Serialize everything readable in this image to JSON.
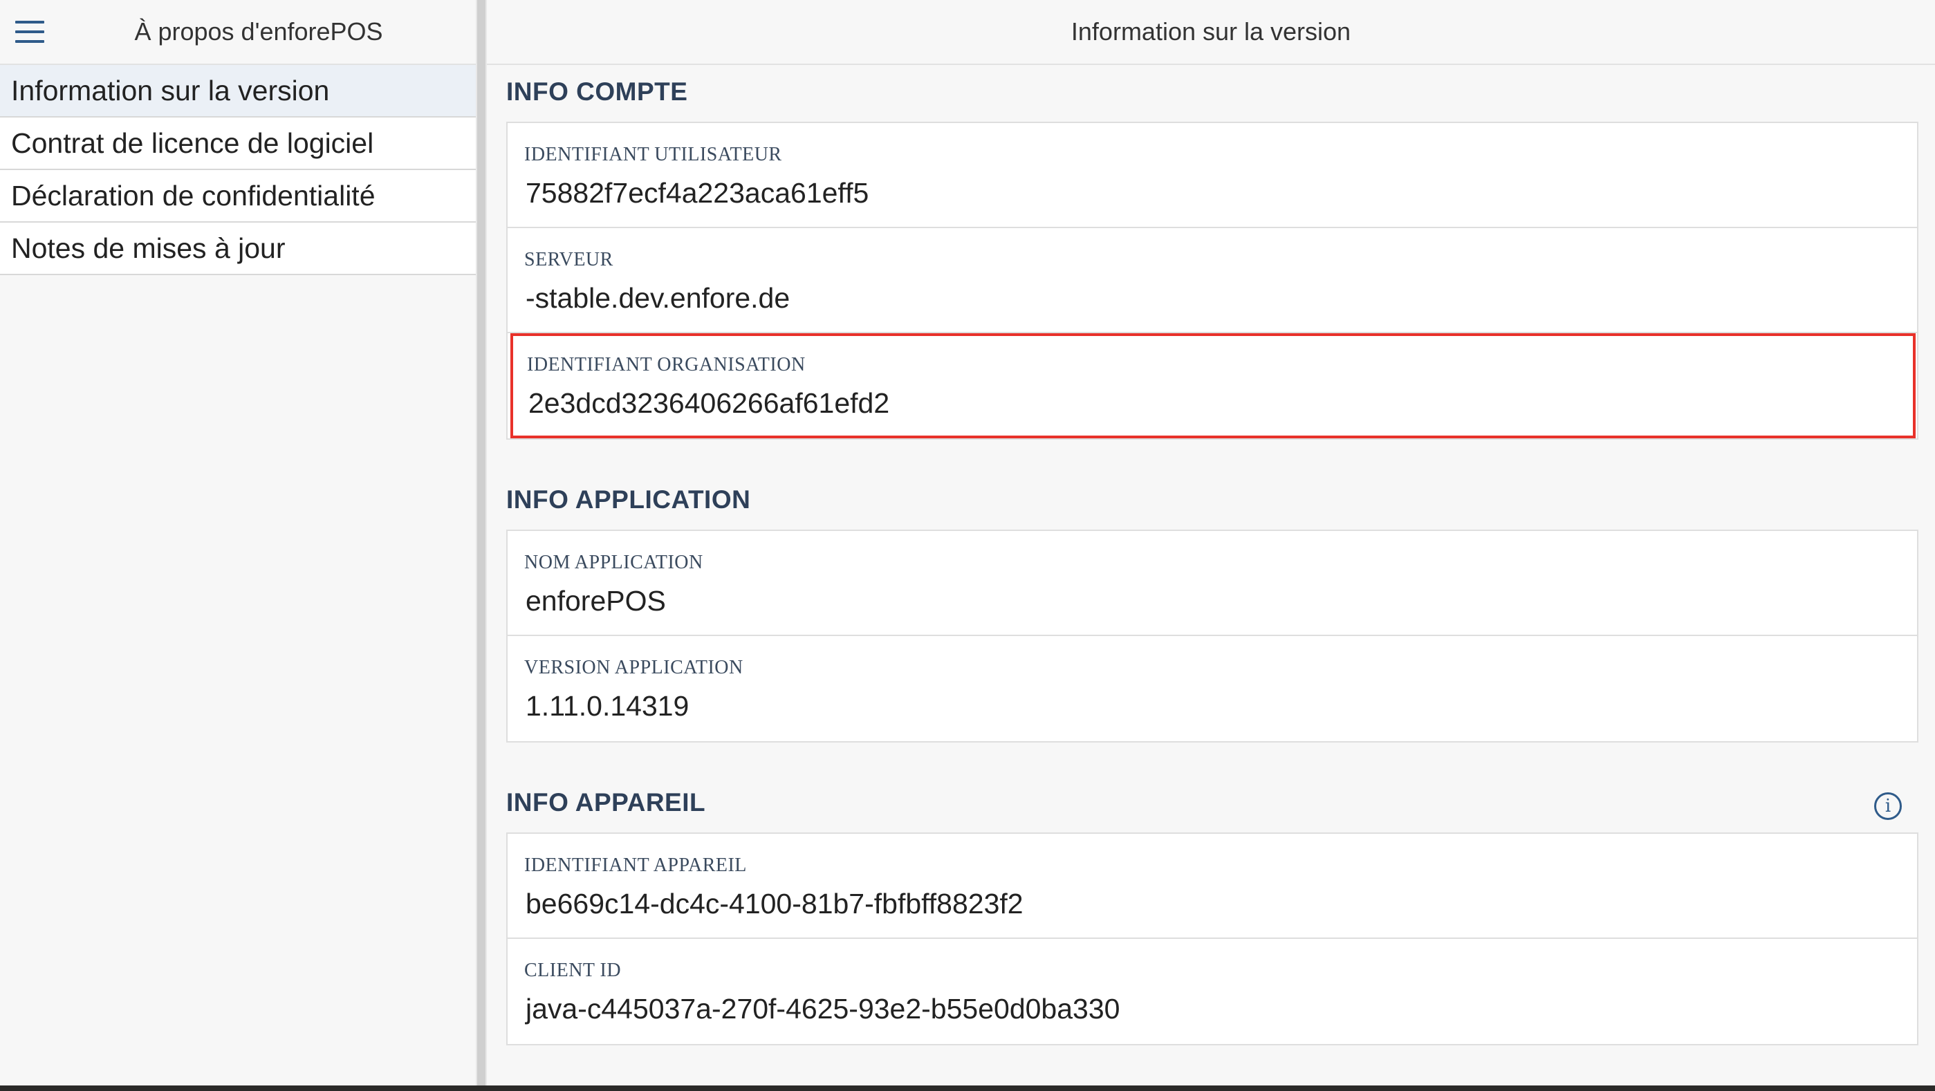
{
  "sidebar": {
    "menu_icon": "menu-icon",
    "title": "À propos d'enforePOS",
    "items": [
      {
        "label": "Information sur la version",
        "active": true
      },
      {
        "label": "Contrat de licence de logiciel",
        "active": false
      },
      {
        "label": "Déclaration de confidentialité",
        "active": false
      },
      {
        "label": "Notes de mises à jour",
        "active": false
      }
    ]
  },
  "main": {
    "title": "Information sur la version",
    "sections": {
      "compte": {
        "title": "INFO COMPTE",
        "rows": [
          {
            "label": "IDENTIFIANT UTILISATEUR",
            "value": "75882f7ecf4a223aca61eff5"
          },
          {
            "label": "SERVEUR",
            "value": "-stable.dev.enfore.de"
          },
          {
            "label": "IDENTIFIANT ORGANISATION",
            "value": "2e3dcd3236406266af61efd2"
          }
        ]
      },
      "application": {
        "title": "INFO APPLICATION",
        "rows": [
          {
            "label": "NOM APPLICATION",
            "value": "enforePOS"
          },
          {
            "label": "VERSION APPLICATION",
            "value": "1.11.0.14319"
          }
        ]
      },
      "appareil": {
        "title": "INFO APPAREIL",
        "info_icon": "info-icon",
        "rows": [
          {
            "label": "IDENTIFIANT APPAREIL",
            "value": "be669c14-dc4c-4100-81b7-fbfbff8823f2"
          },
          {
            "label": "CLIENT ID",
            "value": "java-c445037a-270f-4625-93e2-b55e0d0ba330"
          }
        ]
      }
    }
  },
  "colors": {
    "accent": "#2f5b8a",
    "section_title": "#2e4059",
    "highlight_border": "#e8312a",
    "active_nav_bg": "#ebf0f6"
  }
}
